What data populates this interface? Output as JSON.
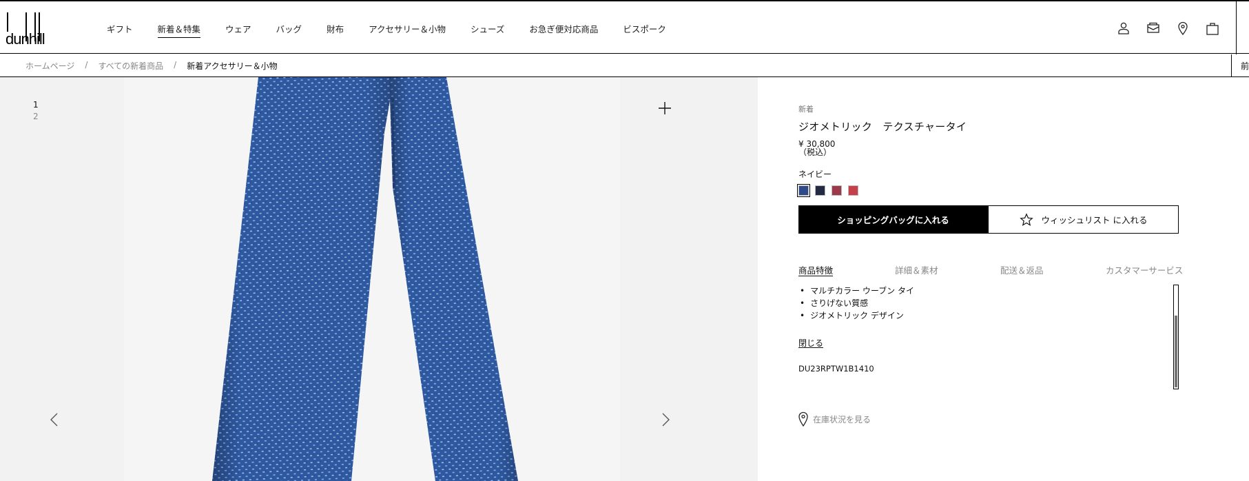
{
  "brand": "dunhill",
  "nav": [
    {
      "label": "ギフト"
    },
    {
      "label": "新着＆特集",
      "active": true
    },
    {
      "label": "ウェア"
    },
    {
      "label": "バッグ"
    },
    {
      "label": "財布"
    },
    {
      "label": "アクセサリー＆小物"
    },
    {
      "label": "シューズ"
    },
    {
      "label": "お急ぎ便対応商品"
    },
    {
      "label": "ビスポーク"
    }
  ],
  "header_icons": [
    "account-icon",
    "mail-icon",
    "store-locator-icon",
    "shopping-bag-icon"
  ],
  "breadcrumb": {
    "items": [
      "ホームページ",
      "すべての新着商品"
    ],
    "separator": "/",
    "current": "新着アクセサリー＆小物",
    "right_text": "前"
  },
  "gallery": {
    "thumbs": [
      "1",
      "2"
    ],
    "image_colors": {
      "background": "#f6f5f5",
      "tie": "#2f5aa0",
      "pattern": "#9ec0e8"
    }
  },
  "product": {
    "badge": "新着",
    "name": "ジオメトリック　テクスチャータイ",
    "price": "¥ 30,800",
    "tax_note": "（税込）",
    "color_name": "ネイビー",
    "swatches": [
      {
        "color": "#2f4a8a",
        "selected": true
      },
      {
        "color": "#232a42",
        "selected": false
      },
      {
        "color": "#9a3a4a",
        "selected": false
      },
      {
        "color": "#c6404c",
        "selected": false
      }
    ],
    "add_to_bag": "ショッピングバッグに入れる",
    "add_to_wishlist": "ウィッシュリスト に入れる",
    "tabs": [
      {
        "label": "商品特徴",
        "active": true
      },
      {
        "label": "詳細＆素材",
        "active": false
      },
      {
        "label": "配送＆返品",
        "active": false
      },
      {
        "label": "カスタマーサービス",
        "active": false
      }
    ],
    "features": [
      "マルチカラー ウーブン タイ",
      "さりげない質感",
      "ジオメトリック デザイン"
    ],
    "close_label": "閉じる",
    "sku": "DU23RPTW1B1410",
    "stock_label": "在庫状況を見る"
  }
}
